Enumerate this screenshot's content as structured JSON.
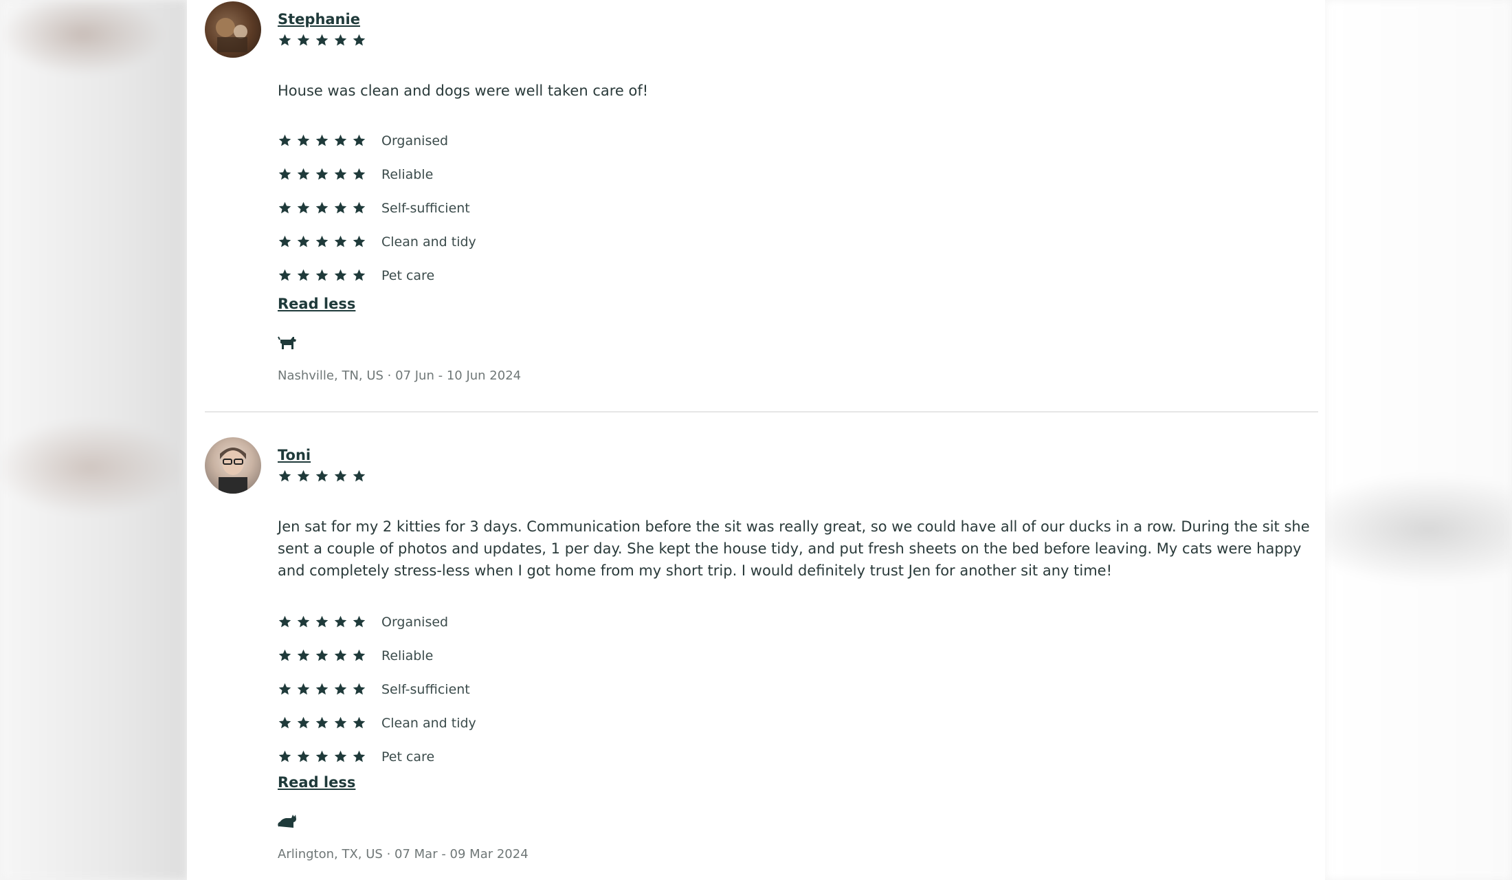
{
  "reviews": [
    {
      "reviewer_name": "Stephanie",
      "overall_rating": 5,
      "text": "House was clean and dogs were well taken care of!",
      "categories": [
        {
          "label": "Organised",
          "rating": 5
        },
        {
          "label": "Reliable",
          "rating": 5
        },
        {
          "label": "Self-sufficient",
          "rating": 5
        },
        {
          "label": "Clean and tidy",
          "rating": 5
        },
        {
          "label": "Pet care",
          "rating": 5
        }
      ],
      "read_less_label": "Read less",
      "pet_icon": "dog-icon",
      "meta": "Nashville, TN, US · 07 Jun - 10 Jun 2024"
    },
    {
      "reviewer_name": "Toni",
      "overall_rating": 5,
      "text": "Jen sat for my 2 kitties for 3 days. Communication before the sit was really great, so we could have all of our ducks in a row. During the sit she sent a couple of photos and updates, 1 per day. She kept the house tidy, and put fresh sheets on the bed before leaving. My cats were happy and completely stress-less when I got home from my short trip. I would definitely trust Jen for another sit any time!",
      "categories": [
        {
          "label": "Organised",
          "rating": 5
        },
        {
          "label": "Reliable",
          "rating": 5
        },
        {
          "label": "Self-sufficient",
          "rating": 5
        },
        {
          "label": "Clean and tidy",
          "rating": 5
        },
        {
          "label": "Pet care",
          "rating": 5
        }
      ],
      "read_less_label": "Read less",
      "pet_icon": "cat-icon",
      "meta": "Arlington, TX, US · 07 Mar - 09 Mar 2024"
    }
  ],
  "colors": {
    "star": "#1f3a3a",
    "text": "#2a3a3a",
    "meta": "#6f7777"
  }
}
